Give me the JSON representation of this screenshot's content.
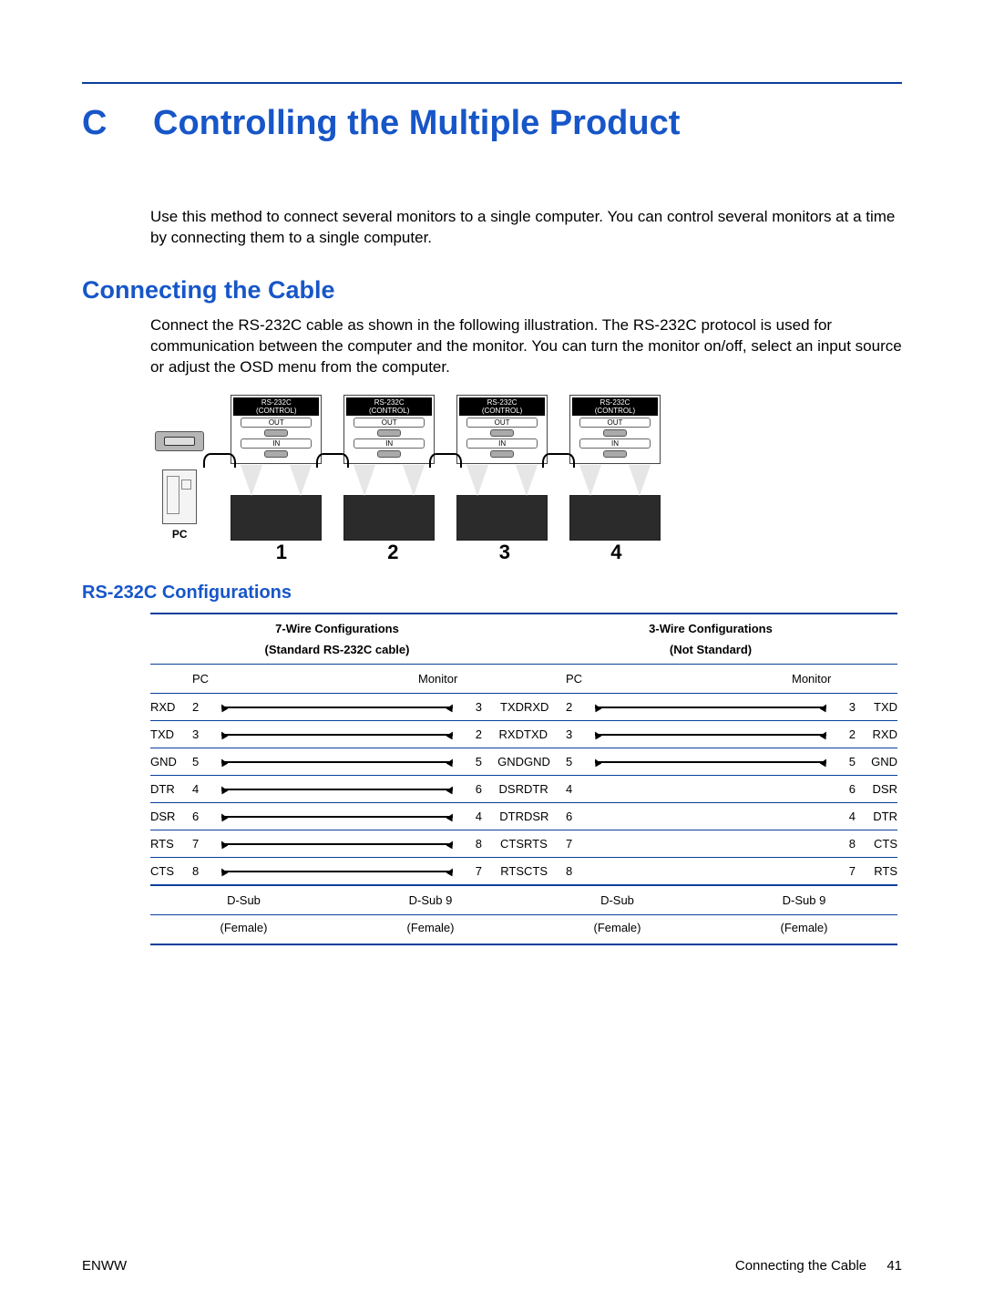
{
  "appendix": {
    "letter": "C",
    "title": "Controlling the Multiple Product"
  },
  "intro": "Use this method to connect several monitors to a single computer. You can control several monitors at a time by connecting them to a single computer.",
  "h2": "Connecting the Cable",
  "cable_text": "Connect the RS-232C cable as shown in the following illustration. The RS-232C protocol is used for communication between the computer and the monitor. You can turn the monitor on/off, select an input source or adjust the OSD menu from the computer.",
  "diagram": {
    "pc_label": "PC",
    "box_title": "RS-232C",
    "box_sub": "(CONTROL)",
    "out": "OUT",
    "in": "IN",
    "numbers": [
      "1",
      "2",
      "3",
      "4"
    ]
  },
  "h3": "RS-232C Configurations",
  "cfg": {
    "left_title": "7-Wire Configurations",
    "left_sub": "(Standard RS-232C cable)",
    "right_title": "3-Wire Configurations",
    "right_sub": "(Not Standard)",
    "col_pc": "PC",
    "col_mon": "Monitor",
    "rows": [
      {
        "l": "RXD",
        "lp": "2",
        "rp": "3",
        "r": "TXD",
        "wl": true,
        "wr": true
      },
      {
        "l": "TXD",
        "lp": "3",
        "rp": "2",
        "r": "RXD",
        "wl": true,
        "wr": true
      },
      {
        "l": "GND",
        "lp": "5",
        "rp": "5",
        "r": "GND",
        "wl": true,
        "wr": true
      },
      {
        "l": "DTR",
        "lp": "4",
        "rp": "6",
        "r": "DSR",
        "wl": true,
        "wr": false
      },
      {
        "l": "DSR",
        "lp": "6",
        "rp": "4",
        "r": "DTR",
        "wl": true,
        "wr": false
      },
      {
        "l": "RTS",
        "lp": "7",
        "rp": "8",
        "r": "CTS",
        "wl": true,
        "wr": false
      },
      {
        "l": "CTS",
        "lp": "8",
        "rp": "7",
        "r": "RTS",
        "wl": true,
        "wr": false
      }
    ],
    "connector1": "D-Sub",
    "connector2": "D-Sub 9",
    "gender": "(Female)"
  },
  "footer": {
    "left": "ENWW",
    "right_label": "Connecting the Cable",
    "page": "41"
  }
}
